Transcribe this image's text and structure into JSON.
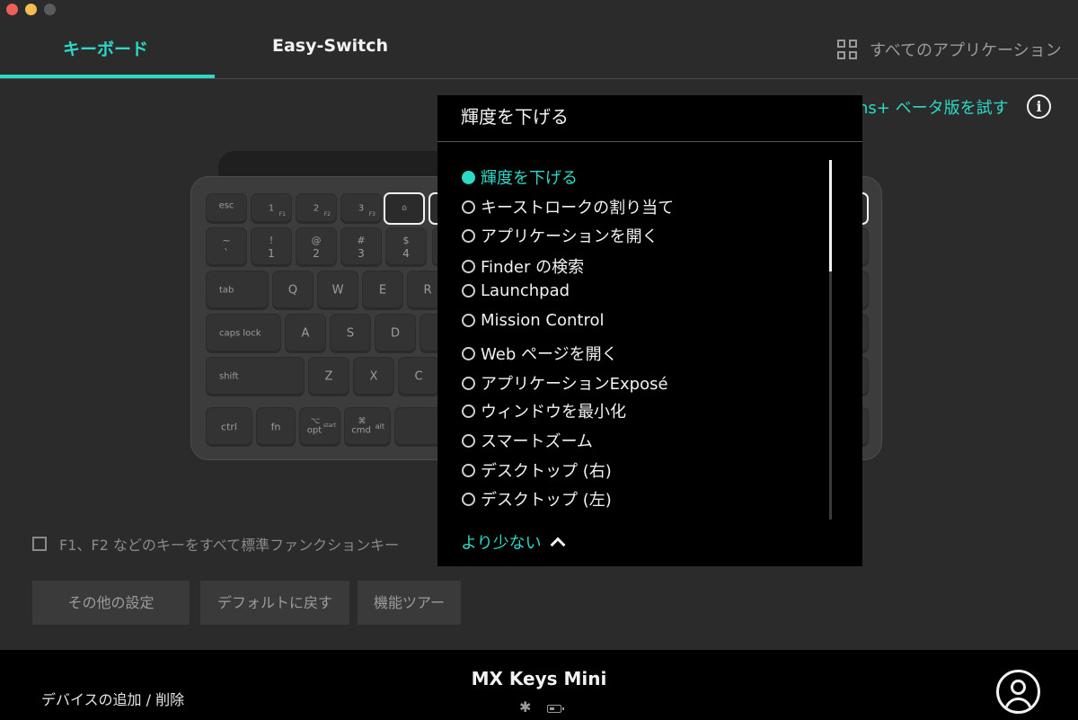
{
  "tabs": {
    "keyboard": "キーボード",
    "easy_switch": "Easy-Switch",
    "all_apps": "すべてのアプリケーション"
  },
  "beta_link": "ns+ ベータ版を試す",
  "info_icon": "i",
  "keyboard": {
    "row_fn": [
      "esc",
      "1",
      "2",
      "3"
    ],
    "row_num": [
      {
        "top": "~",
        "bot": "`"
      },
      {
        "top": "!",
        "bot": "1"
      },
      {
        "top": "@",
        "bot": "2"
      },
      {
        "top": "#",
        "bot": "3"
      },
      {
        "top": "$",
        "bot": "4"
      }
    ],
    "row_q": [
      "tab",
      "Q",
      "W",
      "E",
      "R"
    ],
    "row_a": [
      "caps lock",
      "A",
      "S",
      "D"
    ],
    "row_z": [
      "shift",
      "Z",
      "X",
      "C"
    ],
    "row_bottom": [
      "ctrl",
      "fn",
      "opt",
      "cmd"
    ],
    "sub_labels": {
      "f1": "F1",
      "f2": "F2",
      "f3": "F3",
      "start": "start",
      "alt": "alt"
    }
  },
  "fkeys_checkbox_label": "F1、F2 などのキーをすべて標準ファンクションキー",
  "buttons": {
    "more_settings": "その他の設定",
    "restore_default": "デフォルトに戻す",
    "tour": "機能ツアー"
  },
  "footer": {
    "add_remove": "デバイスの追加 / 削除",
    "device_name": "MX Keys Mini"
  },
  "dropdown": {
    "title": "輝度を下げる",
    "items": [
      "輝度を下げる",
      "キーストロークの割り当て",
      "アプリケーションを開く",
      "Finder の検索",
      "Launchpad",
      "Mission Control",
      "Web ページを開く",
      "アプリケーションExposé",
      "ウィンドウを最小化",
      "スマートズーム",
      "デスクトップ (右)",
      "デスクトップ (左)"
    ],
    "selected_index": 0,
    "show_less": "より少ない"
  },
  "colors": {
    "accent": "#2bd9c6",
    "background": "#2b2b2b",
    "dropdown_bg": "#000000"
  }
}
